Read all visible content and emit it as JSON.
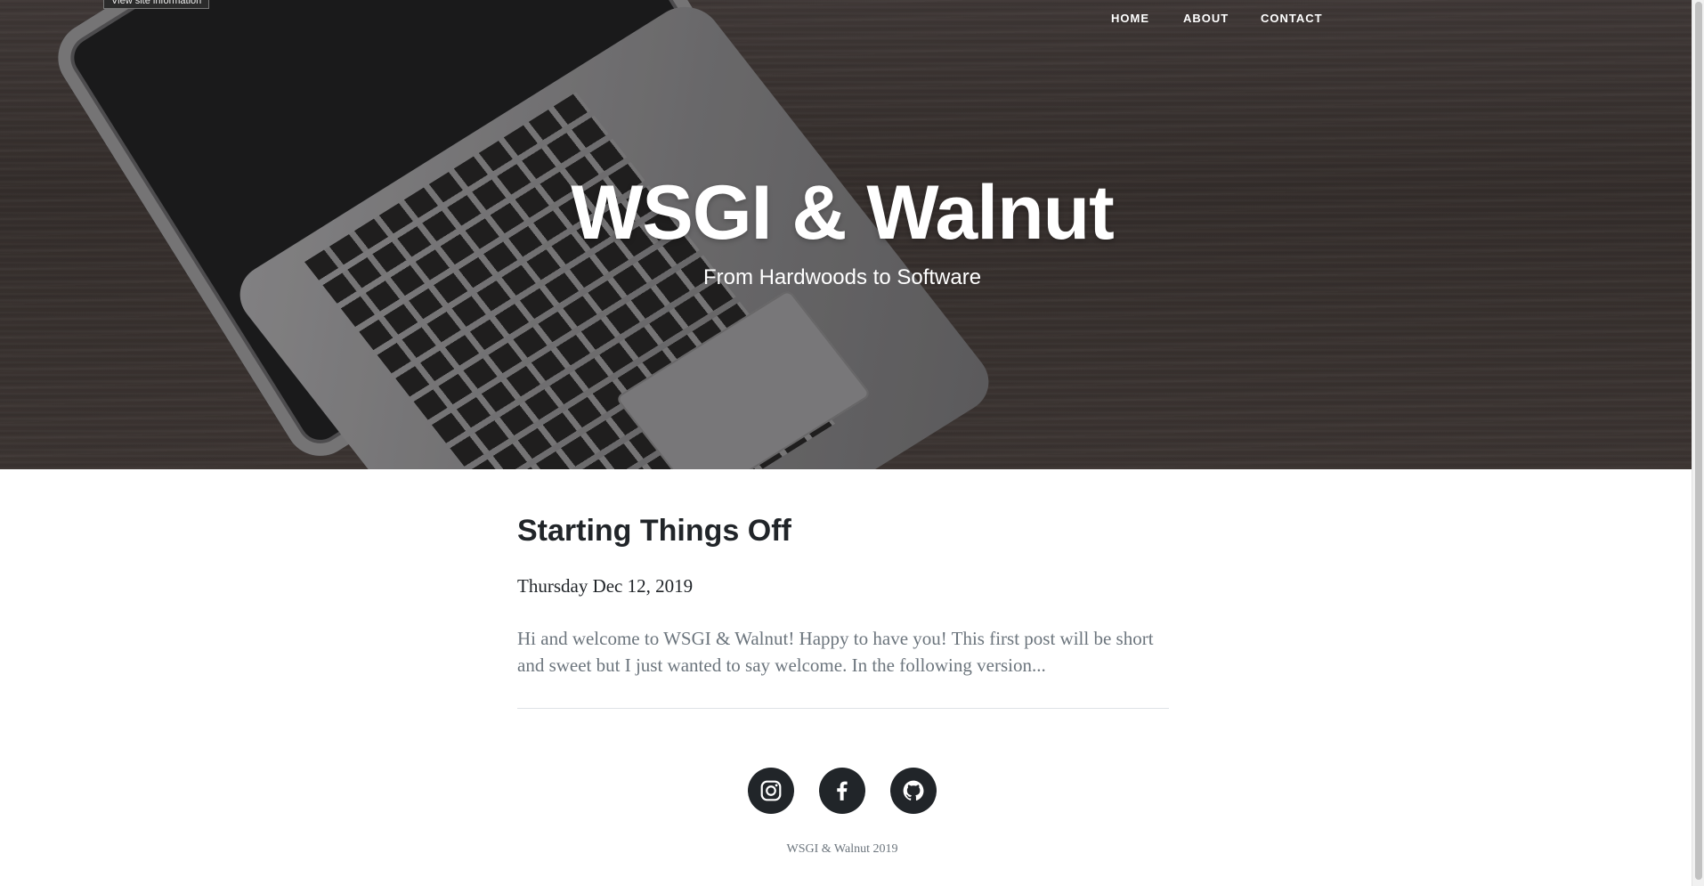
{
  "browser": {
    "site_info_button": "View site information"
  },
  "nav": {
    "home": "HOME",
    "about": "ABOUT",
    "contact": "CONTACT"
  },
  "hero": {
    "title": "WSGI & Walnut",
    "subtitle": "From Hardwoods to Software"
  },
  "post": {
    "title": "Starting Things Off",
    "date": "Thursday Dec 12, 2019",
    "excerpt": "Hi and welcome to WSGI & Walnut! Happy to have you! This first post will be short and sweet but I just wanted to say welcome. In the following version..."
  },
  "footer": {
    "social_icons": [
      "instagram-icon",
      "facebook-icon",
      "github-icon"
    ],
    "copyright": "WSGI & Walnut 2019"
  },
  "colors": {
    "dark": "#212529",
    "muted": "#6c757d",
    "divider": "#dee2e6"
  }
}
